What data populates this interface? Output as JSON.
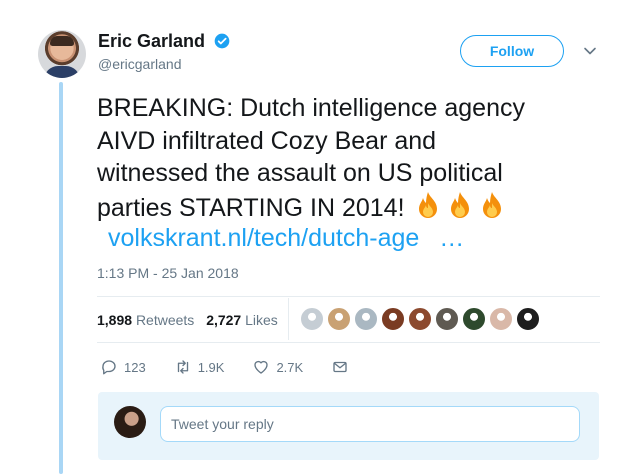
{
  "author": {
    "name": "Eric Garland",
    "handle": "@ericgarland",
    "verified_icon": "verified-badge-icon"
  },
  "follow_label": "Follow",
  "tweet": {
    "lines": [
      "BREAKING: Dutch intelligence agency",
      "AIVD infiltrated Cozy Bear and",
      "witnessed the assault on US political",
      "parties STARTING IN 2014!"
    ],
    "emoji": "fire-emoji x3",
    "link_text": "volkskrant.nl/tech/dutch-age",
    "link_ellipsis": "…",
    "timestamp": "1:13 PM - 25 Jan 2018"
  },
  "stats": {
    "retweets_count": "1,898",
    "retweets_label": "Retweets",
    "likes_count": "2,727",
    "likes_label": "Likes",
    "liker_colors": [
      "#c5cdd4",
      "#c9a173",
      "#aab8c2",
      "#7a3b22",
      "#8c4a2f",
      "#5f5a52",
      "#2e4a2d",
      "#d9b8a8",
      "#1d1d1d"
    ]
  },
  "actions": {
    "reply_count": "123",
    "retweet_count": "1.9K",
    "like_count": "2.7K"
  },
  "reply": {
    "placeholder": "Tweet your reply"
  },
  "colors": {
    "accent": "#1da1f2",
    "thread_line": "#a9d6f5",
    "muted": "#657786"
  }
}
